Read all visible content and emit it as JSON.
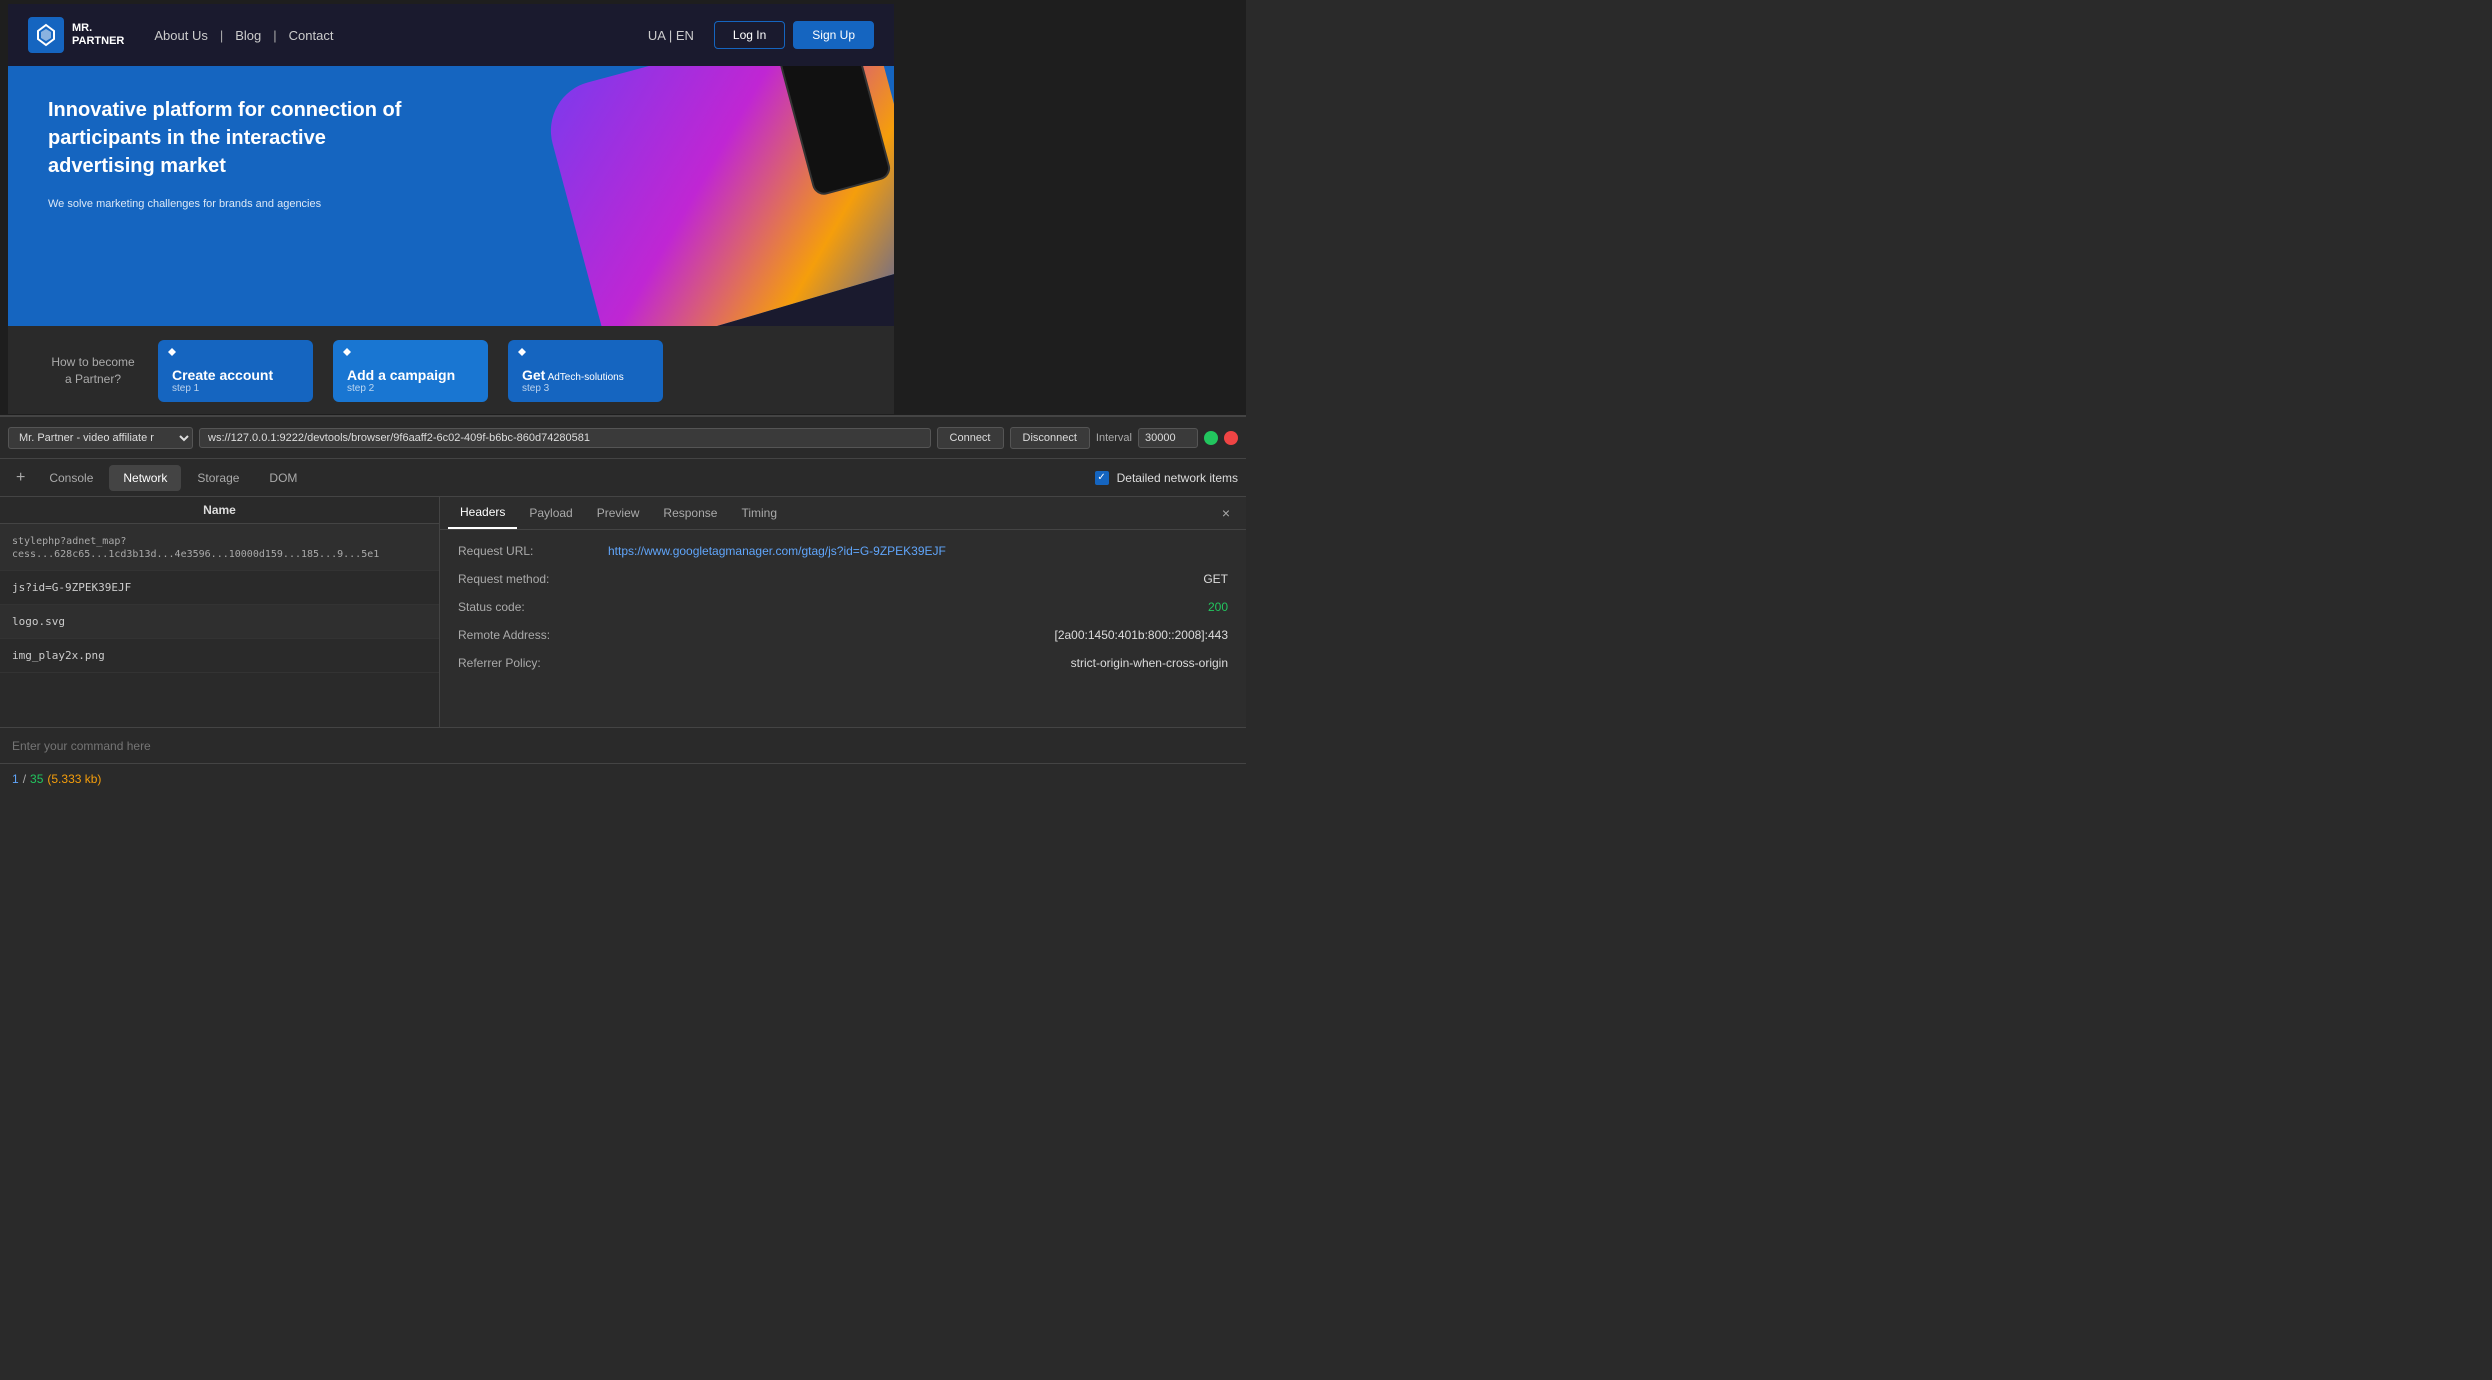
{
  "nav": {
    "logo_line1": "MR.",
    "logo_line2": "PARTNER",
    "links": [
      "About Us",
      "Blog",
      "Contact"
    ],
    "lang": "UA | EN",
    "login_label": "Log In",
    "signup_label": "Sign Up"
  },
  "hero": {
    "title": "Innovative platform for connection of participants in the interactive advertising market",
    "subtitle": "We solve marketing challenges for brands and agencies"
  },
  "steps": {
    "label_line1": "How to become",
    "label_line2": "a Partner?",
    "cards": [
      {
        "title": "Create account",
        "step": "step 1"
      },
      {
        "title": "Add a campaign",
        "step": "step 2"
      },
      {
        "title_main": "Get",
        "title_small": " AdTech-solutions",
        "step": "step 3"
      }
    ]
  },
  "devtools": {
    "profile": "Mr. Partner - video affiliate r",
    "ws_url": "ws://127.0.0.1:9222/devtools/browser/9f6aaff2-6c02-409f-b6bc-860d74280581",
    "connect_label": "Connect",
    "disconnect_label": "Disconnect",
    "interval_label": "Interval",
    "interval_value": "30000"
  },
  "tabs": {
    "plus": "+",
    "items": [
      "Console",
      "Network",
      "Storage",
      "DOM"
    ],
    "active": "Network",
    "detailed_label": "Detailed network items"
  },
  "network": {
    "name_header": "Name",
    "items": [
      {
        "name": "stylephp?adnet_map?cess...628c65...1cd3b13d...4e3596...10000d159...185...9...5e1"
      },
      {
        "name": "js?id=G-9ZPEK39EJF"
      },
      {
        "name": "logo.svg"
      },
      {
        "name": "img_play2x.png"
      }
    ],
    "detail_tabs": [
      "Headers",
      "Payload",
      "Preview",
      "Response",
      "Timing"
    ],
    "active_detail_tab": "Headers",
    "close_label": "×",
    "request_url_label": "Request URL:",
    "request_url_value": "https://www.googletagmanager.com/gtag/js?id=G-9ZPEK39EJF",
    "method_label": "Request method:",
    "method_value": "GET",
    "status_label": "Status code:",
    "status_value": "200",
    "remote_label": "Remote Address:",
    "remote_value": "[2a00:1450:401b:800::2008]:443",
    "referrer_label": "Referrer Policy:",
    "referrer_value": "strict-origin-when-cross-origin"
  },
  "command": {
    "placeholder": "Enter your command here"
  },
  "statusbar": {
    "count": "1",
    "separator": "/",
    "total": "35",
    "size": "(5.333 kb)"
  }
}
